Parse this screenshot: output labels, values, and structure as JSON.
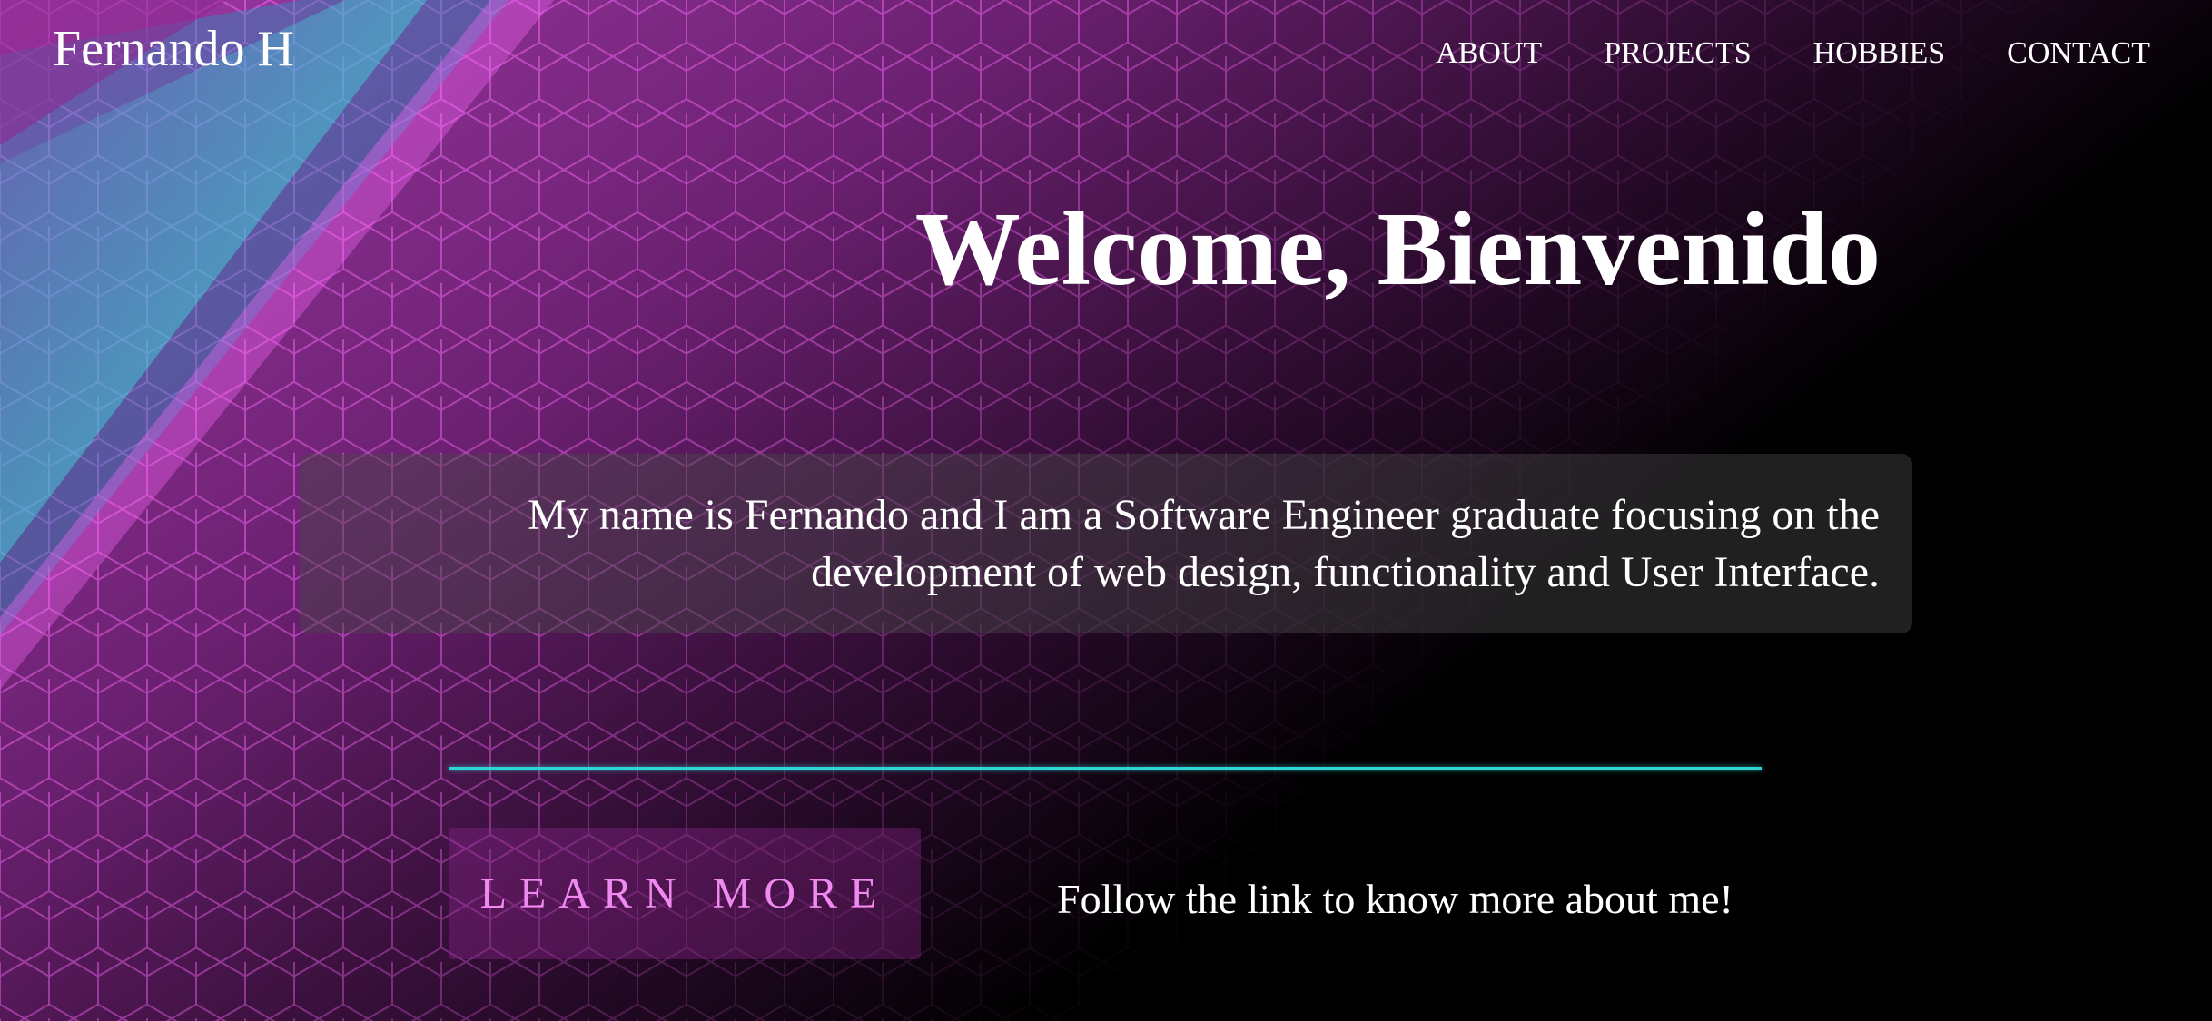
{
  "header": {
    "brand": "Fernando H",
    "nav": [
      "ABOUT",
      "PROJECTS",
      "HOBBIES",
      "CONTACT"
    ]
  },
  "hero": {
    "title": "Welcome, Bienvenido",
    "intro": "My name is Fernando and I am a Software Engineer graduate focusing on the development of web design, functionality and User Interface.",
    "button_label": "LEARN MORE",
    "follow_text": "Follow the link to know more about me!"
  },
  "colors": {
    "background": "#000000",
    "pattern_magenta": "#ff55ff",
    "pattern_cyan": "#40e0e0",
    "accent_line": "#2fd6d6",
    "button_text": "#f08af0"
  }
}
